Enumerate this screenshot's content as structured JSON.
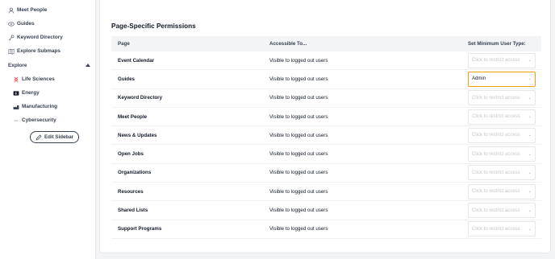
{
  "sidebar": {
    "items": [
      {
        "label": "Meet People",
        "icon": "person-icon"
      },
      {
        "label": "Guides",
        "icon": "eye-icon"
      },
      {
        "label": "Keyword Directory",
        "icon": "key-icon"
      },
      {
        "label": "Explore Submaps",
        "icon": "map-icon"
      }
    ],
    "explore": {
      "label": "Explore",
      "items": [
        {
          "label": "Life Sciences",
          "icon": "dna-icon",
          "icon_color": "#ef4444"
        },
        {
          "label": "Energy",
          "icon": "battery-icon",
          "icon_color": "#111827"
        },
        {
          "label": "Manufacturing",
          "icon": "factory-icon",
          "icon_color": "#374151"
        },
        {
          "label": "Cybersecurity",
          "icon": "dash-icon",
          "icon_color": "#9ca3af"
        }
      ]
    },
    "edit_button": "Edit Sidebar"
  },
  "main": {
    "section_title": "Page-Specific Permissions",
    "headers": {
      "page": "Page",
      "access": "Accessible To...",
      "type": "Set Minimum User Type:"
    },
    "rows": [
      {
        "page": "Event Calendar",
        "access": "Visible to logged out users",
        "type": "Click to restrict access",
        "active": false
      },
      {
        "page": "Guides",
        "access": "Visible to logged out users",
        "type": "Admin",
        "active": true
      },
      {
        "page": "Keyword Directory",
        "access": "Visible to logged out users",
        "type": "Click to restrict access",
        "active": false
      },
      {
        "page": "Meet People",
        "access": "Visible to logged out users",
        "type": "Click to restrict access",
        "active": false
      },
      {
        "page": "News & Updates",
        "access": "Visible to logged out users",
        "type": "Click to restrict access",
        "active": false
      },
      {
        "page": "Open Jobs",
        "access": "Visible to logged out users",
        "type": "Click to restrict access",
        "active": false
      },
      {
        "page": "Organizations",
        "access": "Visible to logged out users",
        "type": "Click to restrict access",
        "active": false
      },
      {
        "page": "Resources",
        "access": "Visible to logged out users",
        "type": "Click to restrict access",
        "active": false
      },
      {
        "page": "Shared Lists",
        "access": "Visible to logged out users",
        "type": "Click to restrict access",
        "active": false
      },
      {
        "page": "Support Programs",
        "access": "Visible to logged out users",
        "type": "Click to restrict access",
        "active": false
      }
    ]
  },
  "colors": {
    "accent": "#f59e0b",
    "header_bg": "#f3f4f6"
  }
}
